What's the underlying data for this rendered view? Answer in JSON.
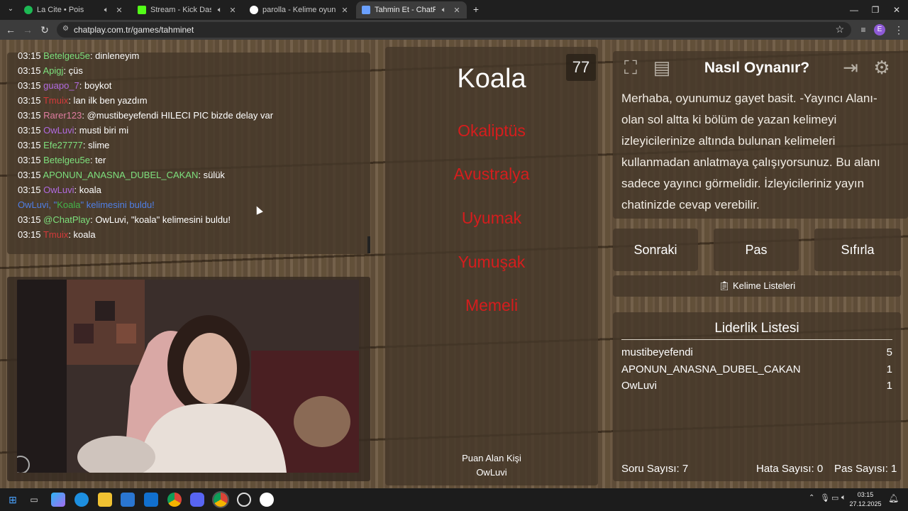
{
  "browser": {
    "tabs": [
      {
        "title": "La Cite • Pois",
        "favicon_color": "#1db954",
        "active": false
      },
      {
        "title": "Stream - Kick Dashboard",
        "favicon_color": "#53fc18",
        "active": false
      },
      {
        "title": "parolla - Kelime oyunu. Günlük",
        "favicon_color": "#ffffff",
        "active": false
      },
      {
        "title": "Tahmin Et - ChatPlay",
        "favicon_color": "#6aa0ff",
        "active": true
      }
    ],
    "new_tab": "+",
    "url": "chatplay.com.tr/games/tahminet",
    "profile_initial": "E"
  },
  "chat": {
    "lines": [
      {
        "time": "03:15",
        "user": "Betelgeu5e",
        "user_color": "#7de07d",
        "msg": ": dinleneyim"
      },
      {
        "time": "03:15",
        "user": "Apigj",
        "user_color": "#7de07d",
        "msg": ": çüs"
      },
      {
        "time": "03:15",
        "user": "guapo_7",
        "user_color": "#b06ae0",
        "msg": ": boykot"
      },
      {
        "time": "03:15",
        "user": "Tmuix",
        "user_color": "#d33a3a",
        "msg": ": lan ilk ben yazdım"
      },
      {
        "time": "03:15",
        "user": "Rarer123",
        "user_color": "#e07da0",
        "msg": ": @mustibeyefendi HILECI PIC bizde delay var"
      },
      {
        "time": "03:15",
        "user": "OwLuvi",
        "user_color": "#b06ae0",
        "msg": ": musti biri mi"
      },
      {
        "time": "03:15",
        "user": "Efe27777",
        "user_color": "#7de07d",
        "msg": ": slime"
      },
      {
        "time": "03:15",
        "user": "Betelgeu5e",
        "user_color": "#7de07d",
        "msg": ": ter"
      },
      {
        "time": "03:15",
        "user": "APONUN_ANASNA_DUBEL_CAKAN",
        "user_color": "#7de07d",
        "msg": ": sülük"
      },
      {
        "time": "03:15",
        "user": "OwLuvi",
        "user_color": "#b06ae0",
        "msg": ": koala"
      },
      {
        "time": "03:15",
        "user": "@ChatPlay",
        "user_color": "#7de07d",
        "msg": ": OwLuvi, \"koala\" kelimesini buldu!"
      },
      {
        "time": "03:15",
        "user": "Tmuix",
        "user_color": "#d33a3a",
        "msg": ": koala"
      }
    ],
    "system_notice": {
      "user": "OwLuvi,",
      "quote_open": " \"",
      "word": "Koala",
      "quote_close": "\"",
      "rest": " kelimesini buldu!",
      "color": "#4f7fe6",
      "word_color": "#43b64a"
    }
  },
  "game": {
    "counter": "77",
    "target_word": "Koala",
    "forbidden_words": [
      "Okaliptüs",
      "Avustralya",
      "Uyumak",
      "Yumuşak",
      "Memeli"
    ],
    "forbidden_color": "#d51d1d",
    "scorer_label": "Puan Alan Kişi",
    "scorer_name": "OwLuvi"
  },
  "how_to": {
    "title": "Nasıl Oynanır?",
    "text": "Merhaba, oyunumuz gayet basit. -Yayıncı Alanı- olan sol altta ki bölüm de yazan kelimeyi izleyicilerinize altında bulunan kelimeleri kullanmadan anlatmaya çalışıyorsunuz. Bu alanı sadece yayıncı görmelidir. İzleyicileriniz yayın chatinizde cevap verebilir."
  },
  "controls": {
    "next": "Sonraki",
    "pass": "Pas",
    "reset": "Sıfırla",
    "word_lists_icon": "clipboard-icon",
    "word_lists": "Kelime Listeleri"
  },
  "leaderboard": {
    "title": "Liderlik Listesi",
    "rows": [
      {
        "name": "mustibeyefendi",
        "score": "5"
      },
      {
        "name": "APONUN_ANASNA_DUBEL_CAKAN",
        "score": "1"
      },
      {
        "name": "OwLuvi",
        "score": "1"
      }
    ],
    "question_count": "Soru Sayısı: 7",
    "error_count": "Hata Sayısı: 0",
    "pass_count": "Pas Sayısı: 1"
  },
  "taskbar": {
    "time": "03:15",
    "date": "27.12.2025"
  }
}
